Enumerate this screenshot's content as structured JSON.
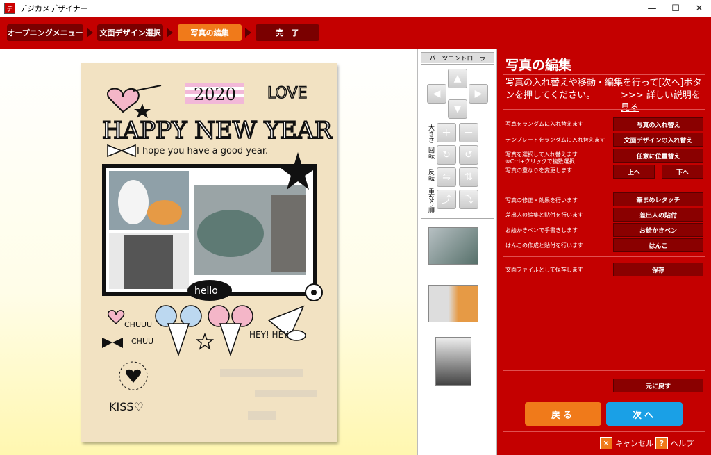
{
  "window": {
    "title": "デジカメデザイナー",
    "minimize": "—",
    "maximize": "☐",
    "close": "✕"
  },
  "steps": [
    {
      "label": "オープニングメニュー"
    },
    {
      "label": "文面デザイン選択"
    },
    {
      "label": "写真の編集"
    },
    {
      "label": "完　了"
    }
  ],
  "card": {
    "year": "2020",
    "love": "LOVE",
    "happy": "HAPPY NEW YEAR",
    "greeting": "I hope you have a good year.",
    "hello": "hello",
    "chuuu1": "CHUUU",
    "chuuu2": "CHUU",
    "hey": "HEY! HEY!",
    "kiss": "KISS♡"
  },
  "parts": {
    "title": "パーツコントローラ",
    "labels": {
      "size": "大きさ",
      "rotate": "回転",
      "flip": "反転",
      "order": "重なり順"
    }
  },
  "side": {
    "title": "写真の編集",
    "desc": "写真の入れ替えや移動・編集を行って[次へ]ボタンを押してください。",
    "link": ">>> 詳しい説明を見る",
    "rows": [
      {
        "label": "写真をランダムに入れ替えます",
        "button": "写真の入れ替え"
      },
      {
        "label": "テンプレートをランダムに入れ替えます",
        "button": "文面デザインの入れ替え"
      },
      {
        "label": "写真を選択して入れ替えます",
        "sub": "※Ctrl+クリックで複数選択",
        "button": "任意に位置替え"
      },
      {
        "label": "写真の重なりを変更します",
        "btn_up": "上へ",
        "btn_down": "下へ"
      },
      {
        "label": "写真の修正・効果を行います",
        "button": "筆まめレタッチ"
      },
      {
        "label": "差出人の編集と貼付を行います",
        "button": "差出人の貼付"
      },
      {
        "label": "お絵かきペンで手書きします",
        "button": "お絵かきペン"
      },
      {
        "label": "はんこの作成と貼付を行います",
        "button": "はんこ"
      },
      {
        "label": "文面ファイルとして保存します",
        "button": "保存"
      }
    ],
    "undo": "元に戻す",
    "back": "戻る",
    "next": "次へ",
    "cancel": "キャンセル",
    "help": "ヘルプ"
  },
  "colors": {
    "accent": "#c40000",
    "active_step": "#f07a1a",
    "next_btn": "#1aa0e6"
  }
}
